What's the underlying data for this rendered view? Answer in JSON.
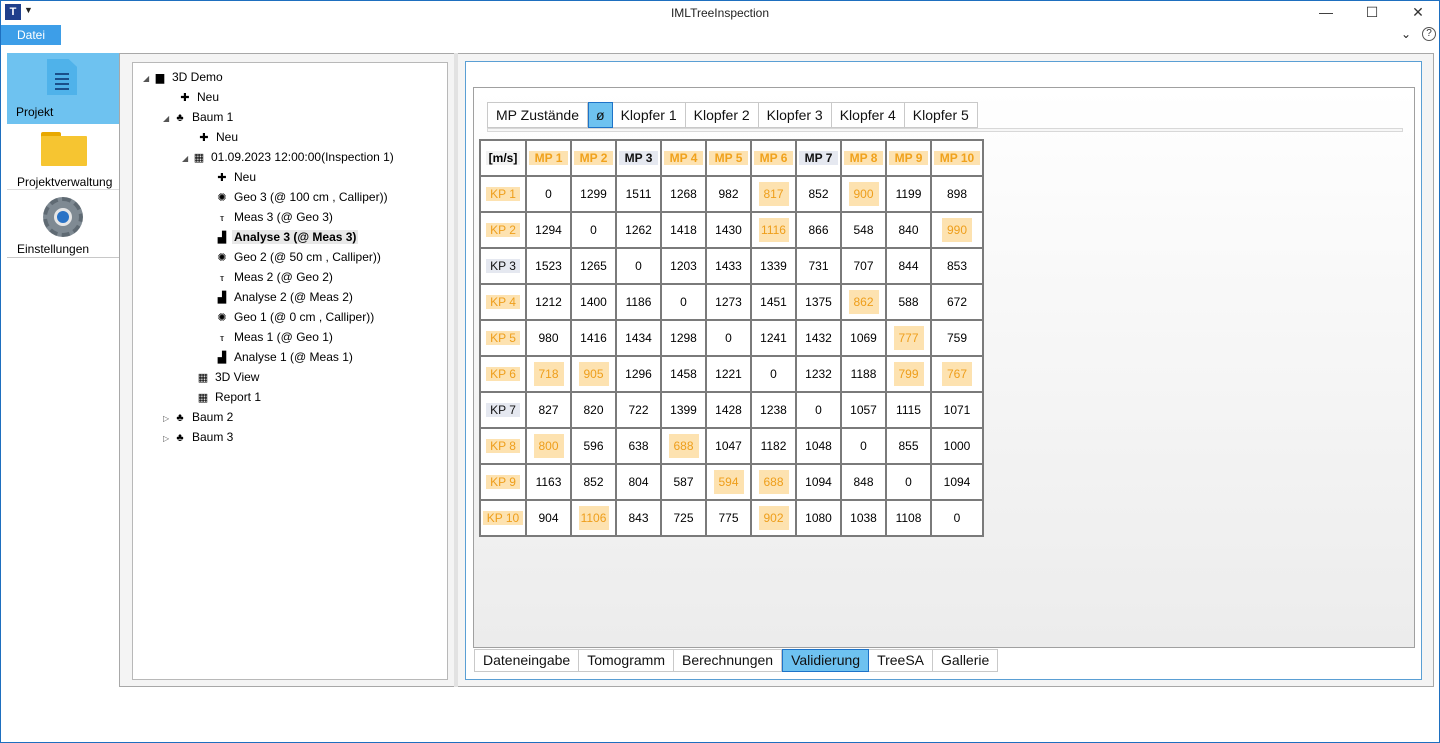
{
  "window": {
    "title": "IMLTreeInspection",
    "app_icon": "T"
  },
  "menu": {
    "file": "Datei"
  },
  "nav": [
    {
      "label": "Projekt",
      "icon": "document-icon",
      "active": true
    },
    {
      "label": "Projektverwaltung",
      "icon": "folder-icon",
      "active": false
    },
    {
      "label": "Einstellungen",
      "icon": "gear-icon",
      "active": false
    }
  ],
  "tree": {
    "root": "3D Demo",
    "new_root": "Neu",
    "tree1": "Baum 1",
    "new_tree1": "Neu",
    "inspection": "01.09.2023 12:00:00(Inspection 1)",
    "new_insp": "Neu",
    "geo3": "Geo 3 (@ 100 cm , Calliper))",
    "meas3": "Meas 3 (@ Geo 3)",
    "analyse3": "Analyse 3 (@ Meas 3)",
    "geo2": "Geo 2 (@ 50 cm , Calliper))",
    "meas2": "Meas 2 (@ Geo 2)",
    "analyse2": "Analyse 2 (@ Meas 2)",
    "geo1": "Geo 1 (@ 0 cm , Calliper))",
    "meas1": "Meas 1 (@ Geo 1)",
    "analyse1": "Analyse 1 (@ Meas 1)",
    "view3d": "3D View",
    "report1": "Report 1",
    "tree2": "Baum 2",
    "tree3": "Baum 3"
  },
  "subtabs": [
    "MP Zustände",
    "ø",
    "Klopfer 1",
    "Klopfer 2",
    "Klopfer 3",
    "Klopfer 4",
    "Klopfer 5"
  ],
  "active_subtab": 1,
  "grid": {
    "unit": "[m/s]",
    "columns": [
      "MP 1",
      "MP 2",
      "MP 3",
      "MP 4",
      "MP 5",
      "MP 6",
      "MP 7",
      "MP 8",
      "MP 9",
      "MP 10"
    ],
    "column_highlight": [
      true,
      true,
      false,
      true,
      true,
      true,
      false,
      true,
      true,
      true
    ],
    "rows": [
      {
        "label": "KP 1",
        "hl": true,
        "values": [
          "0",
          "1299",
          "1511",
          "1268",
          "982",
          "817",
          "852",
          "900",
          "1199",
          "898"
        ],
        "highlight": [
          false,
          false,
          false,
          false,
          false,
          true,
          false,
          true,
          false,
          false
        ]
      },
      {
        "label": "KP 2",
        "hl": true,
        "values": [
          "1294",
          "0",
          "1262",
          "1418",
          "1430",
          "1116",
          "866",
          "548",
          "840",
          "990"
        ],
        "highlight": [
          false,
          false,
          false,
          false,
          false,
          true,
          false,
          false,
          false,
          true
        ]
      },
      {
        "label": "KP 3",
        "hl": false,
        "values": [
          "1523",
          "1265",
          "0",
          "1203",
          "1433",
          "1339",
          "731",
          "707",
          "844",
          "853"
        ],
        "highlight": [
          false,
          false,
          false,
          false,
          false,
          false,
          false,
          false,
          false,
          false
        ]
      },
      {
        "label": "KP 4",
        "hl": true,
        "values": [
          "1212",
          "1400",
          "1186",
          "0",
          "1273",
          "1451",
          "1375",
          "862",
          "588",
          "672"
        ],
        "highlight": [
          false,
          false,
          false,
          false,
          false,
          false,
          false,
          true,
          false,
          false
        ]
      },
      {
        "label": "KP 5",
        "hl": true,
        "values": [
          "980",
          "1416",
          "1434",
          "1298",
          "0",
          "1241",
          "1432",
          "1069",
          "777",
          "759"
        ],
        "highlight": [
          false,
          false,
          false,
          false,
          false,
          false,
          false,
          false,
          true,
          false
        ]
      },
      {
        "label": "KP 6",
        "hl": true,
        "values": [
          "718",
          "905",
          "1296",
          "1458",
          "1221",
          "0",
          "1232",
          "1188",
          "799",
          "767"
        ],
        "highlight": [
          true,
          true,
          false,
          false,
          false,
          false,
          false,
          false,
          true,
          true
        ]
      },
      {
        "label": "KP 7",
        "hl": false,
        "values": [
          "827",
          "820",
          "722",
          "1399",
          "1428",
          "1238",
          "0",
          "1057",
          "1115",
          "1071"
        ],
        "highlight": [
          false,
          false,
          false,
          false,
          false,
          false,
          false,
          false,
          false,
          false
        ]
      },
      {
        "label": "KP 8",
        "hl": true,
        "values": [
          "800",
          "596",
          "638",
          "688",
          "1047",
          "1182",
          "1048",
          "0",
          "855",
          "1000"
        ],
        "highlight": [
          true,
          false,
          false,
          true,
          false,
          false,
          false,
          false,
          false,
          false
        ]
      },
      {
        "label": "KP 9",
        "hl": true,
        "values": [
          "1163",
          "852",
          "804",
          "587",
          "594",
          "688",
          "1094",
          "848",
          "0",
          "1094"
        ],
        "highlight": [
          false,
          false,
          false,
          false,
          true,
          true,
          false,
          false,
          false,
          false
        ]
      },
      {
        "label": "KP 10",
        "hl": true,
        "values": [
          "904",
          "1106",
          "843",
          "725",
          "775",
          "902",
          "1080",
          "1038",
          "1108",
          "0"
        ],
        "highlight": [
          false,
          true,
          false,
          false,
          false,
          true,
          false,
          false,
          false,
          false
        ]
      }
    ]
  },
  "bottomtabs": [
    "Dateneingabe",
    "Tomogramm",
    "Berechnungen",
    "Validierung",
    "TreeSA",
    "Gallerie"
  ],
  "active_bottomtab": 3,
  "colors": {
    "accent": "#6ec2f0",
    "highlight_bg": "#fde2b0",
    "highlight_text": "#ee9e1b",
    "menu_bg": "#3d9ee8"
  }
}
